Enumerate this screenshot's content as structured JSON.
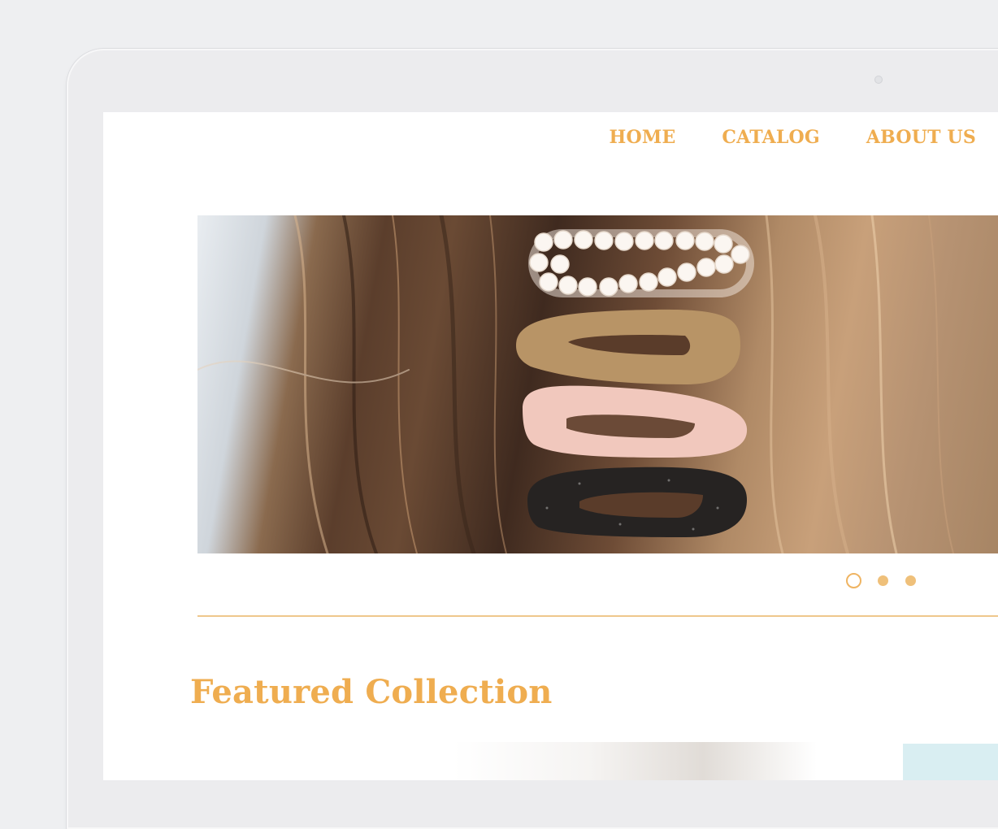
{
  "nav": {
    "home": "HOME",
    "catalog": "CATALOG",
    "about": "ABOUT US"
  },
  "hero": {
    "image": "hair-clips-photo",
    "slides": 3,
    "active_slide": 1
  },
  "featured": {
    "title": "Featured Collection"
  },
  "colors": {
    "accent": "#efad50",
    "accent_light": "#efc07a",
    "divider": "#efc78c"
  }
}
